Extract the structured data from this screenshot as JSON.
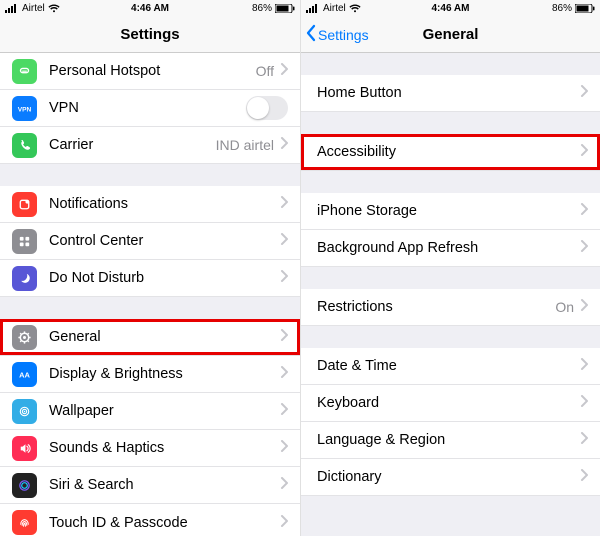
{
  "status": {
    "carrier": "Airtel",
    "time": "4:46 AM",
    "battery": "86%"
  },
  "left": {
    "title": "Settings",
    "items": {
      "hotspot": {
        "label": "Personal Hotspot",
        "detail": "Off"
      },
      "vpn": {
        "label": "VPN"
      },
      "carrier": {
        "label": "Carrier",
        "detail": "IND airtel"
      },
      "notifications": {
        "label": "Notifications"
      },
      "control": {
        "label": "Control Center"
      },
      "dnd": {
        "label": "Do Not Disturb"
      },
      "general": {
        "label": "General"
      },
      "display": {
        "label": "Display & Brightness"
      },
      "wallpaper": {
        "label": "Wallpaper"
      },
      "sounds": {
        "label": "Sounds & Haptics"
      },
      "siri": {
        "label": "Siri & Search"
      },
      "touchid": {
        "label": "Touch ID & Passcode"
      }
    }
  },
  "right": {
    "back": "Settings",
    "title": "General",
    "items": {
      "home": {
        "label": "Home Button"
      },
      "access": {
        "label": "Accessibility"
      },
      "storage": {
        "label": "iPhone Storage"
      },
      "bgrefresh": {
        "label": "Background App Refresh"
      },
      "restrict": {
        "label": "Restrictions",
        "detail": "On"
      },
      "datetime": {
        "label": "Date & Time"
      },
      "keyboard": {
        "label": "Keyboard"
      },
      "lang": {
        "label": "Language & Region"
      },
      "dict": {
        "label": "Dictionary"
      }
    }
  }
}
